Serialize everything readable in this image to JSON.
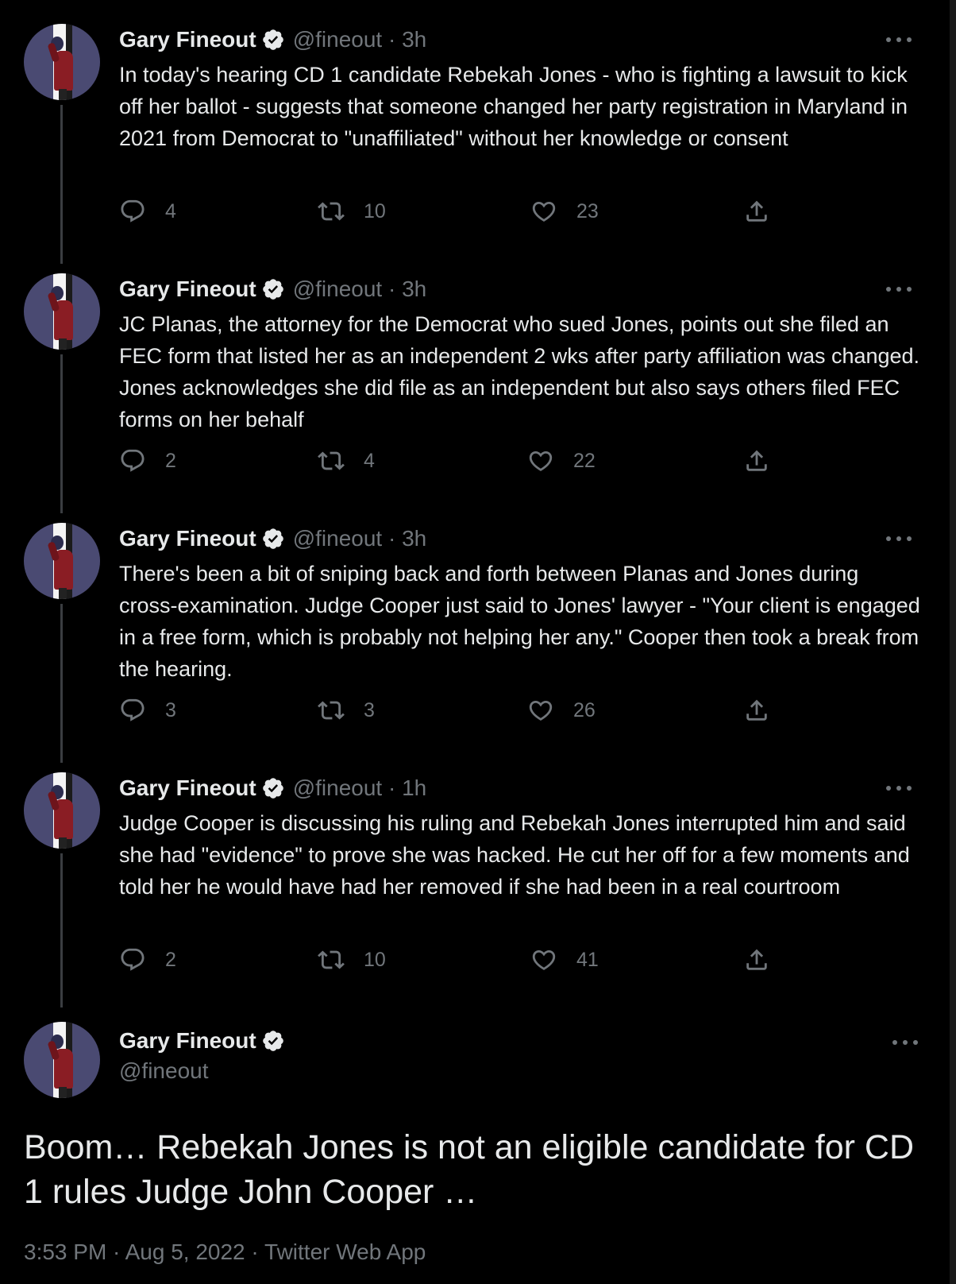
{
  "author": {
    "name": "Gary Fineout",
    "handle": "@fineout"
  },
  "thread": [
    {
      "time_line": "@fineout · 3h",
      "text": "In today's hearing CD 1 candidate Rebekah Jones - who is fighting a lawsuit to kick off her ballot - suggests that someone changed her party registration in Maryland in 2021 from Democrat to \"unaffiliated\" without her knowledge or consent",
      "replies": "4",
      "retweets": "10",
      "likes": "23"
    },
    {
      "time_line": "@fineout · 3h",
      "text": "JC Planas, the attorney for the Democrat who sued Jones, points out she filed an FEC form that listed her as an independent 2 wks after party affiliation was changed. Jones acknowledges she did file as an independent but also says others filed FEC forms on her behalf",
      "replies": "2",
      "retweets": "4",
      "likes": "22"
    },
    {
      "time_line": "@fineout · 3h",
      "text": "There's been a bit of sniping back and forth between Planas and Jones during cross-examination. Judge Cooper just said to Jones' lawyer - \"Your client is engaged in a free form, which is probably not helping her any.\" Cooper then took a break from the hearing.",
      "replies": "3",
      "retweets": "3",
      "likes": "26"
    },
    {
      "time_line": "@fineout · 1h",
      "text": "Judge Cooper is discussing his ruling and Rebekah Jones interrupted him and said she had \"evidence\" to prove she was hacked. He cut her off for a few moments and told her he would have had her removed if she had been in a real courtroom",
      "replies": "2",
      "retweets": "10",
      "likes": "41"
    }
  ],
  "main_tweet": {
    "text": "Boom… Rebekah Jones is not an eligible candidate for CD 1 rules Judge John Cooper …",
    "meta": "3:53 PM · Aug 5, 2022 · Twitter Web App"
  },
  "icons": {
    "verified": "verified-badge-icon",
    "more": "more-options-icon",
    "reply": "reply-icon",
    "retweet": "retweet-icon",
    "like": "like-icon",
    "share": "share-icon"
  },
  "colors": {
    "background": "#000000",
    "text": "#e7e9ea",
    "secondary": "#71767b",
    "thread_line": "#3a3d41"
  }
}
